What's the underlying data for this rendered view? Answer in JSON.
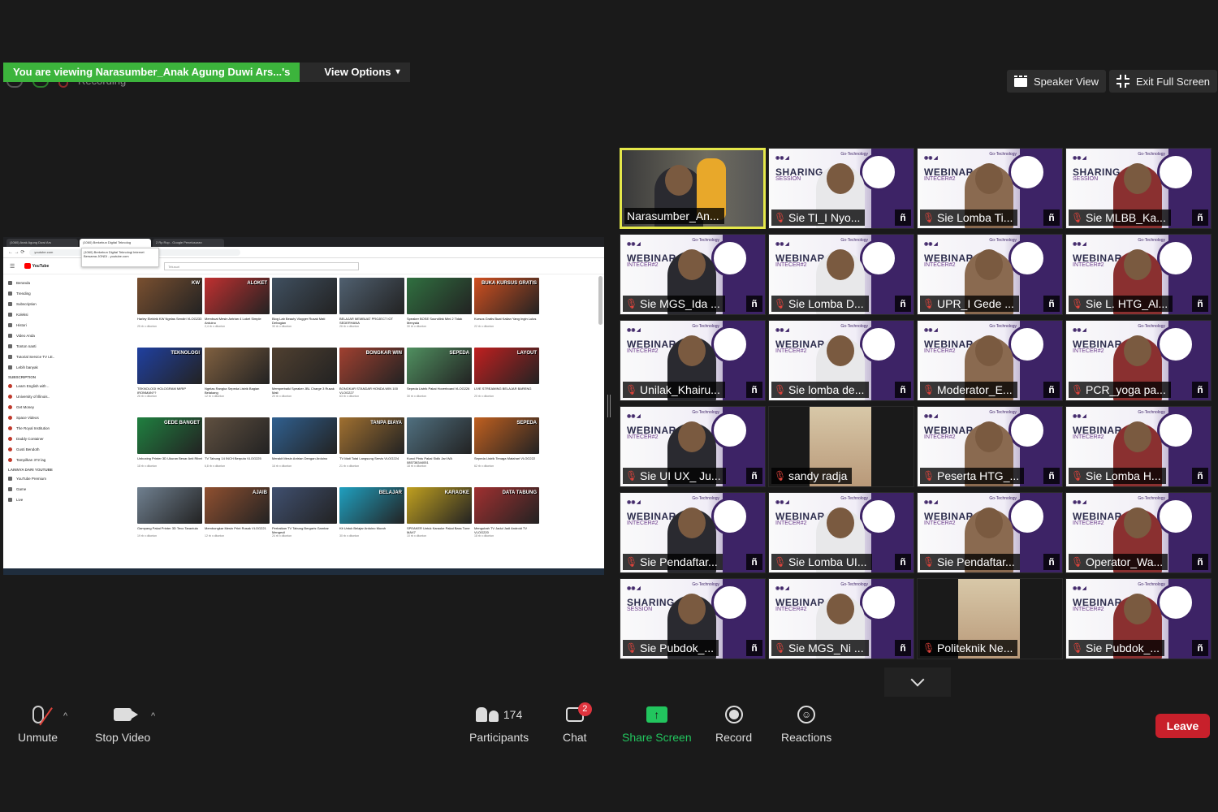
{
  "banner": {
    "viewing_text": "You are viewing Narasumber_Anak Agung Duwi Ars...'s",
    "view_options": "View Options"
  },
  "recording_hint": "Recording",
  "top_buttons": {
    "speaker_view": "Speaker View",
    "exit_full_screen": "Exit Full Screen"
  },
  "shared_screen": {
    "tabs": [
      "(1060) Anak Agung Duwi Ars",
      "(1060) Berkebun Digital Teknolog",
      "2 Rp Rcp - Google Penelusuran"
    ],
    "url": "youtube.com",
    "youtube_logo": "YouTube",
    "search_placeholder": "Telusuri",
    "tooltip": "(1060) Berkebun Digital Teknologi Internet Bersama JONDI - youtube.com",
    "sidebar": {
      "main": [
        "Beranda",
        "Trending",
        "Subscription"
      ],
      "library": [
        "Koleksi",
        "Histori",
        "Video Anda",
        "Tonton nanti",
        "Tutorial Service TV LE..",
        "Lebih banyak"
      ],
      "subs_header": "SUBSCRIPTION",
      "subs": [
        "Learn English with ..",
        "University of Illinois..",
        "Get Money",
        "Space Videos",
        "The Royal Institution",
        "Daddy Container",
        "Gusti Bendoth",
        "Tampilkan 372 lag"
      ],
      "more_header": "LAINNYA DARI YOUTUBE",
      "more": [
        "YouTube Premium",
        "Game",
        "Live"
      ]
    },
    "videos": [
      {
        "title": "Harley Elektrik KW Ngelas Sendiri VLOG233",
        "meta": "25 rb x ditonton",
        "tag": "KW",
        "color": "#7a5030"
      },
      {
        "title": "Membuat Mesin Antrian 4 Loket Simple Arduino",
        "meta": "2,4 rb x ditonton",
        "tag": "ALOKET",
        "color": "#c03030"
      },
      {
        "title": "Blog Lab Beauty Vlogger Rusak Mati Dehagian",
        "meta": "30 rb x ditonton",
        "tag": "",
        "color": "#405060"
      },
      {
        "title": "BELAJAR MEMBUAT PROJECT IOT SEDERHANA",
        "meta": "26 rb x ditonton",
        "tag": "",
        "color": "#506070"
      },
      {
        "title": "Speaker BOSE Soundlink Mini 2 Tidak Menyala",
        "meta": "30 rb x ditonton",
        "tag": "",
        "color": "#307040"
      },
      {
        "title": "Kursus Gratis Buat Kalian Yang Ingin Lulus",
        "meta": "22 rb x ditonton",
        "tag": "BUKA KURSUS GRATIS",
        "color": "#d05020"
      },
      {
        "title": "TEKNOLOGI HOLOGRAM MIRIP IRONMAN??",
        "meta": "26 rb x ditonton",
        "tag": "TEKNOLOGI",
        "color": "#2040a0"
      },
      {
        "title": "Ngelas Rangka Sepeda Listrik Bagian Belakang",
        "meta": "12 rb x ditonton",
        "tag": "",
        "color": "#806040"
      },
      {
        "title": "Memperbaiki Speaker JBL Charge 3 Rusak Mati",
        "meta": "20 rb x ditonton",
        "tag": "",
        "color": "#504030"
      },
      {
        "title": "BONGKAR STANDAR HONDA WIN 100 VLOG227",
        "meta": "63 rb x ditonton",
        "tag": "BONGKAR WIN",
        "color": "#a04030"
      },
      {
        "title": "Sepeda Listrik Pakai Hoverboard VLOG226",
        "meta": "30 rb x ditonton",
        "tag": "SEPEDA",
        "color": "#509060"
      },
      {
        "title": "LIVE STREAMING BELAJAR BARENG",
        "meta": "20 rb x ditonton",
        "tag": "LAYOUT",
        "color": "#c02020"
      },
      {
        "title": "Unboxing Printer 3D Ukuran Besar Anti Ribet",
        "meta": "18 rb x ditonton",
        "tag": "GEDE BANGET",
        "color": "#208040"
      },
      {
        "title": "TV Tabung 14 INCH Berputa VLOG225",
        "meta": "6,8 rb x ditonton",
        "tag": "",
        "color": "#605040"
      },
      {
        "title": "Merakit Mesin Antrian Dengan Arduino",
        "meta": "16 rb x ditonton",
        "tag": "",
        "color": "#306090"
      },
      {
        "title": "TV Mati Total Langsung Servis VLOG224",
        "meta": "21 rb x ditonton",
        "tag": "TANPA BIAYA",
        "color": "#a07030"
      },
      {
        "title": "Kunci Pintu Pakai Sidik Jari WA 085738344051",
        "meta": "18 rb x ditonton",
        "tag": "",
        "color": "#507080"
      },
      {
        "title": "Sepeda Listrik Tenaga Matahari VLOG222",
        "meta": "62 rb x ditonton",
        "tag": "SEPEDA",
        "color": "#c06020"
      },
      {
        "title": "Gampang Pakai Printer 3D Tevo Tarantula",
        "meta": "19 rb x ditonton",
        "tag": "",
        "color": "#708090"
      },
      {
        "title": "Membongkar Mesin Print Rusak VLOG221",
        "meta": "12 rb x ditonton",
        "tag": "AJAIB",
        "color": "#905030"
      },
      {
        "title": "Perbaikan TV Tabung Bergaris Gambar Mengecil",
        "meta": "24 rb x ditonton",
        "tag": "",
        "color": "#405070"
      },
      {
        "title": "Kit Untuk Belajar Arduino Murah",
        "meta": "30 rb x ditonton",
        "tag": "BELAJAR",
        "color": "#20a0c0"
      },
      {
        "title": "SPEAKER Untuk Karaoke Pakai Bass Tune MAX7",
        "meta": "10 rb x ditonton",
        "tag": "KARAOKE",
        "color": "#c0a020"
      },
      {
        "title": "Mengubah TV Jadul Jadi Android TV VLOG220",
        "meta": "18 rb x ditonton",
        "tag": "DATA TABUNG",
        "color": "#a03030"
      }
    ]
  },
  "participants": [
    {
      "name": "Narasumber_An...",
      "muted": false,
      "kind": "narasumber"
    },
    {
      "name": "Sie TI_I Nyo...",
      "muted": true,
      "kind": "sharing"
    },
    {
      "name": "Sie Lomba Ti...",
      "muted": true,
      "kind": "webinar"
    },
    {
      "name": "Sie MLBB_Ka...",
      "muted": true,
      "kind": "sharing"
    },
    {
      "name": "Sie MGS_Ida ...",
      "muted": true,
      "kind": "webinar"
    },
    {
      "name": "Sie Lomba D...",
      "muted": true,
      "kind": "webinar"
    },
    {
      "name": "UPR_I Gede ...",
      "muted": true,
      "kind": "webinar"
    },
    {
      "name": "Sie L. HTG_Al...",
      "muted": true,
      "kind": "webinar"
    },
    {
      "name": "Unilak_Khairu...",
      "muted": true,
      "kind": "webinar"
    },
    {
      "name": "Sie lomba de...",
      "muted": true,
      "kind": "webinar"
    },
    {
      "name": "Moderator_E...",
      "muted": true,
      "kind": "webinar"
    },
    {
      "name": "PCR_yoga pa...",
      "muted": true,
      "kind": "webinar"
    },
    {
      "name": "Sie UI UX_ Ju...",
      "muted": true,
      "kind": "webinar"
    },
    {
      "name": "sandy radja",
      "muted": true,
      "kind": "dark"
    },
    {
      "name": "Peserta HTG_...",
      "muted": true,
      "kind": "webinar"
    },
    {
      "name": "Sie Lomba H...",
      "muted": true,
      "kind": "webinar"
    },
    {
      "name": "Sie Pendaftar...",
      "muted": true,
      "kind": "webinar"
    },
    {
      "name": "Sie Lomba UI...",
      "muted": true,
      "kind": "webinar"
    },
    {
      "name": "Sie Pendaftar...",
      "muted": true,
      "kind": "webinar"
    },
    {
      "name": "Operator_Wa...",
      "muted": true,
      "kind": "webinar"
    },
    {
      "name": "Sie Pubdok_...",
      "muted": true,
      "kind": "sharing"
    },
    {
      "name": "Sie MGS_Ni ...",
      "muted": true,
      "kind": "webinar"
    },
    {
      "name": "Politeknik Ne...",
      "muted": true,
      "kind": "dark"
    },
    {
      "name": "Sie Pubdok_...",
      "muted": true,
      "kind": "webinar"
    }
  ],
  "tile_text": {
    "webinar": "WEBINAR",
    "webinar_sub": "INTECER#2",
    "sharing": "SHARING",
    "sharing_sub": "SESSION",
    "go_tech": "Go-Technology",
    "talk_badge": "ñ"
  },
  "toolbar": {
    "unmute": "Unmute",
    "stop_video": "Stop Video",
    "participants": "Participants",
    "participants_count": "174",
    "chat": "Chat",
    "chat_badge": "2",
    "share_screen": "Share Screen",
    "record": "Record",
    "reactions": "Reactions",
    "leave": "Leave"
  },
  "colors": {
    "banner_green": "#3cb43c",
    "share_green": "#22c55e",
    "leave_red": "#c8202b",
    "active_speaker_border": "#e5e84a",
    "muted_red": "#e0433b"
  }
}
